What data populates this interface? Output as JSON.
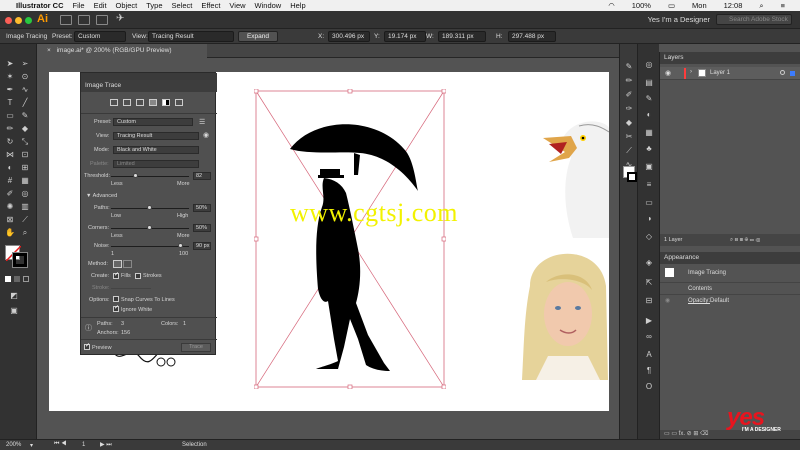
{
  "menubar": {
    "app": "Illustrator CC",
    "items": [
      "File",
      "Edit",
      "Object",
      "Type",
      "Select",
      "Effect",
      "View",
      "Window",
      "Help"
    ],
    "user": "Yes I'm a Designer",
    "battery": "100%",
    "day": "Mon",
    "time": "12:08"
  },
  "appbar": {
    "logo": "Ai",
    "workspace_user": "Yes I'm a Designer",
    "search_placeholder": "Search Adobe Stock"
  },
  "control": {
    "mode": "Image Tracing",
    "preset_label": "Preset:",
    "preset_value": "Custom",
    "view_label": "View:",
    "view_value": "Tracing Result",
    "expand_label": "Expand",
    "x_label": "X:",
    "x_value": "300.496 px",
    "y_label": "Y:",
    "y_value": "19.174 px",
    "w_label": "W:",
    "w_value": "189.311 px",
    "h_label": "H:",
    "h_value": "297.488 px"
  },
  "document": {
    "tab": "image.ai* @ 200% (RGB/GPU Preview)"
  },
  "image_trace": {
    "title": "Image Trace",
    "preset_label": "Preset:",
    "preset_value": "Custom",
    "view_label": "View:",
    "view_value": "Tracing Result",
    "mode_label": "Mode:",
    "mode_value": "Black and White",
    "palette_label": "Palette:",
    "palette_value": "Limited",
    "threshold_label": "Threshold:",
    "threshold_value": "82",
    "threshold_min": "Less",
    "threshold_max": "More",
    "threshold_fraction": 0.32,
    "advanced_label": "Advanced",
    "paths_label": "Paths:",
    "paths_value": "50%",
    "paths_min": "Low",
    "paths_max": "High",
    "paths_fraction": 0.5,
    "corners_label": "Corners:",
    "corners_value": "50%",
    "corners_min": "Less",
    "corners_max": "More",
    "corners_fraction": 0.5,
    "noise_label": "Noise:",
    "noise_value": "90 px",
    "noise_min": "1",
    "noise_max": "100",
    "noise_fraction": 0.9,
    "method_label": "Method:",
    "create_label": "Create:",
    "fills_label": "Fills",
    "strokes_label": "Strokes",
    "stroke_label": "Stroke:",
    "options_label": "Options:",
    "snap_label": "Snap Curves To Lines",
    "ignore_label": "Ignore White",
    "paths_stat_label": "Paths:",
    "paths_stat_value": "3",
    "colors_stat_label": "Colors:",
    "colors_stat_value": "1",
    "anchors_stat_label": "Anchors:",
    "anchors_stat_value": "156",
    "preview_label": "Preview",
    "trace_label": "Trace"
  },
  "layers": {
    "title": "Layers",
    "layer_name": "Layer 1",
    "count": "1 Layer"
  },
  "appearance": {
    "title": "Appearance",
    "object": "Image Tracing",
    "contents": "Contents",
    "opacity_label": "Opacity:",
    "opacity_value": "Default"
  },
  "status": {
    "zoom": "200%",
    "artboard": "1",
    "tool": "Selection"
  },
  "watermark": "www.cgtsj.com",
  "brand": {
    "logo": "yes",
    "tagline": "I'M A DESIGNER"
  },
  "colors": {
    "accent_red": "#e8141e",
    "watermark_yellow": "#f2f200",
    "bounding_box": "#d6667a",
    "layer_color": "#ff3c3c"
  },
  "icons": [
    "apple-icon",
    "wifi-icon",
    "battery-icon",
    "search-icon",
    "menu-icon",
    "eye-icon",
    "info-icon"
  ]
}
